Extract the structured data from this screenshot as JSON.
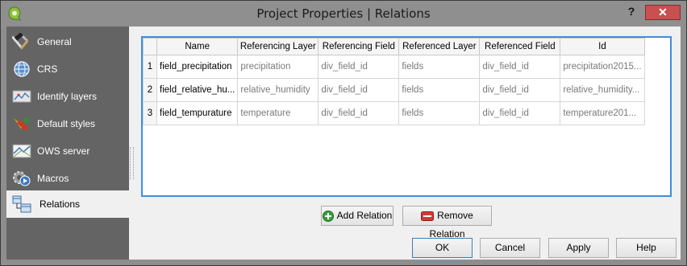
{
  "window": {
    "title": "Project Properties | Relations",
    "help": "?",
    "close": "✕"
  },
  "sidebar": {
    "items": [
      {
        "label": "General",
        "icon": "wrench-hammer-icon"
      },
      {
        "label": "CRS",
        "icon": "globe-icon"
      },
      {
        "label": "Identify layers",
        "icon": "identify-map-icon"
      },
      {
        "label": "Default styles",
        "icon": "paintbrush-icon"
      },
      {
        "label": "OWS server",
        "icon": "ows-map-icon"
      },
      {
        "label": "Macros",
        "icon": "gear-play-icon"
      },
      {
        "label": "Relations",
        "icon": "relations-table-icon",
        "active": true
      }
    ]
  },
  "relations_table": {
    "columns": [
      "Name",
      "Referencing Layer",
      "Referencing Field",
      "Referenced Layer",
      "Referenced Field",
      "Id"
    ],
    "rows": [
      {
        "num": "1",
        "name": "field_precipitation",
        "ref_layer": "precipitation",
        "ref_field": "div_field_id",
        "refd_layer": "fields",
        "refd_field": "div_field_id",
        "id": "precipitation2015..."
      },
      {
        "num": "2",
        "name": "field_relative_hu...",
        "ref_layer": "relative_humidity",
        "ref_field": "div_field_id",
        "refd_layer": "fields",
        "refd_field": "div_field_id",
        "id": "relative_humidity..."
      },
      {
        "num": "3",
        "name": "field_tempurature",
        "ref_layer": "temperature",
        "ref_field": "div_field_id",
        "refd_layer": "fields",
        "refd_field": "div_field_id",
        "id": "temperature201..."
      }
    ]
  },
  "actions": {
    "add_relation": "Add Relation",
    "remove_relation": "Remove Relation"
  },
  "dialog_buttons": {
    "ok": "OK",
    "cancel": "Cancel",
    "apply": "Apply",
    "help": "Help"
  },
  "colors": {
    "selection_border": "#3c8fe0",
    "sidebar_bg": "#646464",
    "close_red": "#c75050"
  }
}
